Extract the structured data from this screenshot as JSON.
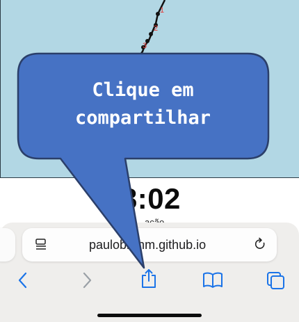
{
  "map": {
    "waypoint_labels": [
      "1",
      "2",
      "3"
    ]
  },
  "timer": {
    "value": "08:02",
    "sublabel": "ação"
  },
  "browser": {
    "url": "paulobrehm.github.io"
  },
  "callout": {
    "line1": "Clique em",
    "line2": "compartilhar"
  },
  "icons": {
    "reader": "reader-mode-icon",
    "reload": "reload-icon",
    "back": "chevron-left-icon",
    "forward": "chevron-right-icon",
    "share": "share-icon",
    "bookmarks": "book-icon",
    "tabs": "tabs-icon"
  },
  "colors": {
    "map_water": "#b2d7e4",
    "callout_fill": "#4672c4",
    "callout_border": "#2b3f6a",
    "toolbar_blue": "#1a73e8",
    "waypoint_red": "#e53935"
  }
}
